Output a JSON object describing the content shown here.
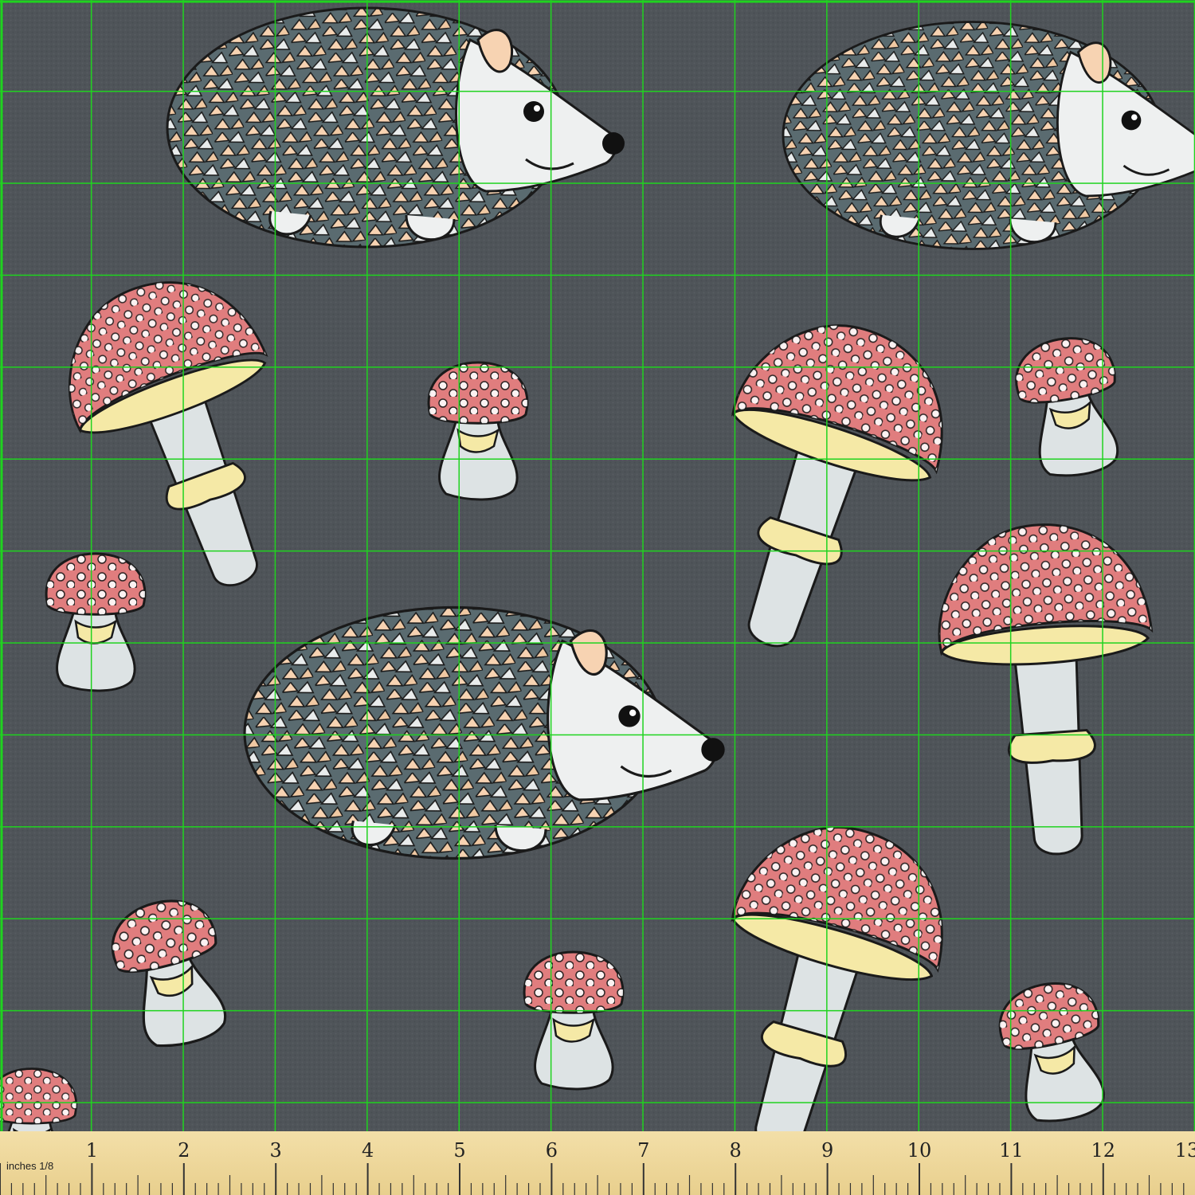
{
  "scene": {
    "description_colors": {
      "background": "#4f5459",
      "grid": "#1fd31f",
      "mushroom_cap": "#e07d7e",
      "mushroom_gills": "#f5e9a6",
      "mushroom_stem": "#dde3e4",
      "quill_peach": "#f7d3b2",
      "quill_slate": "#5a6b70",
      "quill_light": "#e9ecec",
      "outline": "#1a1a1a",
      "ruler": "#f0d99d"
    }
  },
  "ruler": {
    "unit_label": "inches 1/8",
    "numbers": [
      "1",
      "2",
      "3",
      "4",
      "5",
      "6",
      "7",
      "8",
      "9",
      "10",
      "11",
      "12",
      "13"
    ]
  },
  "icons": {
    "hedgehog": "hedgehog-icon",
    "mushroom": "mushroom-icon"
  }
}
